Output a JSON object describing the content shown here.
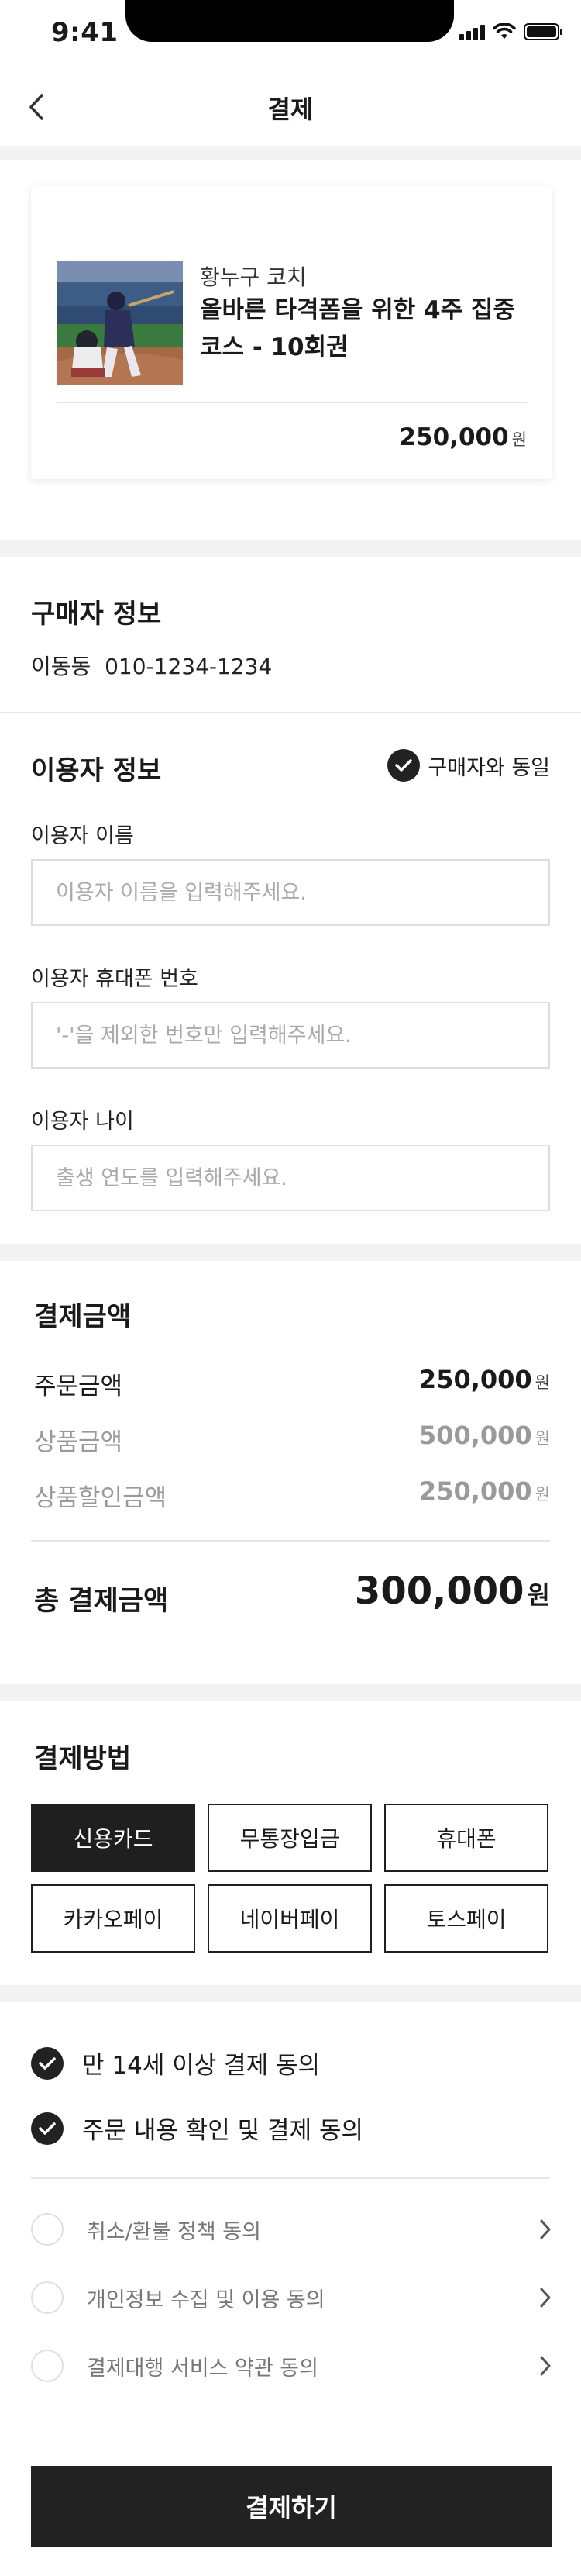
{
  "status_bar": {
    "time": "9:41"
  },
  "header": {
    "title": "결제"
  },
  "product": {
    "coach": "황누구 코치",
    "title": "올바른 타격폼을 위한 4주 집중코스 - 10회권",
    "price": "250,000",
    "currency": "원"
  },
  "buyer": {
    "heading": "구매자 정보",
    "name": "이동동",
    "phone": "010-1234-1234"
  },
  "user_info": {
    "heading": "이용자 정보",
    "same_as_buyer": "구매자와 동일",
    "name_label": "이용자 이름",
    "name_placeholder": "이용자 이름을 입력해주세요.",
    "phone_label": "이용자 휴대폰 번호",
    "phone_placeholder": "'-'을 제외한 번호만 입력해주세요.",
    "age_label": "이용자 나이",
    "age_placeholder": "출생 연도를 입력해주세요."
  },
  "amount": {
    "heading": "결제금액",
    "order_label": "주문금액",
    "order_value": "250,000",
    "product_label": "상품금액",
    "product_value": "500,000",
    "discount_label": "상품할인금액",
    "discount_value": "250,000",
    "total_label": "총 결제금액",
    "total_value": "300,000",
    "currency": "원"
  },
  "payment_method": {
    "heading": "결제방법",
    "options": [
      "신용카드",
      "무통장입금",
      "휴대폰",
      "카카오페이",
      "네이버페이",
      "토스페이"
    ],
    "selected": "신용카드"
  },
  "agreements": {
    "age": "만 14세 이상 결제 동의",
    "order_confirm": "주문 내용 확인 및 결제 동의",
    "refund": "취소/환불 정책 동의",
    "privacy": "개인정보 수집 및 이용 동의",
    "service": "결제대행 서비스 약관 동의"
  },
  "submit": {
    "label": "결제하기"
  }
}
